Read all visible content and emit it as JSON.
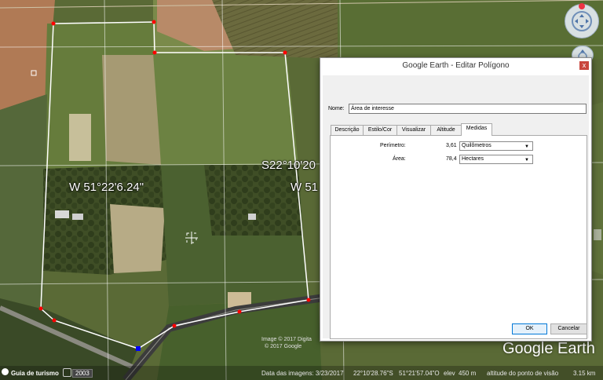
{
  "dialog": {
    "title": "Google Earth - Editar Polígono",
    "close_label": "x",
    "name_label": "Nome:",
    "name_value": "Área de interesse",
    "tabs": [
      {
        "label": "Descrição"
      },
      {
        "label": "Estilo/Cor"
      },
      {
        "label": "Visualizar"
      },
      {
        "label": "Altitude"
      },
      {
        "label": "Medidas"
      }
    ],
    "active_tab": "Medidas",
    "perimeter_label": "Perímetro:",
    "perimeter_value": "3,61",
    "perimeter_unit": "Quilômetros",
    "area_label": "Área:",
    "area_value": "78,4",
    "area_unit": "Hectares",
    "ok_label": "OK",
    "cancel_label": "Cancelar"
  },
  "map": {
    "longitude_label": "W 51°22'6.24\"",
    "latitude_label": "S22°10'20",
    "longitude_label_2": "W 51",
    "imagery_credit_1": "Image © 2017 Digita",
    "imagery_credit_2": "© 2017 Google",
    "logo_text": "Google Earth"
  },
  "status": {
    "tour_guide_label": "Guia de turismo",
    "year_badge": "2003",
    "imagery_date": "Data das imagens: 3/23/2017",
    "lat": "22°10'28.76\"S",
    "lon": "51°21'57.04\"O",
    "elev_label": "elev",
    "elev_value": "450 m",
    "eye_alt_label": "altitude do ponto de visão",
    "eye_alt_value": "3.15 km"
  },
  "colors": {
    "ok_border": "#0078d7",
    "polygon_line": "#ffffff",
    "vertex": "#ff0000",
    "vertex_selected": "#0000ff"
  }
}
